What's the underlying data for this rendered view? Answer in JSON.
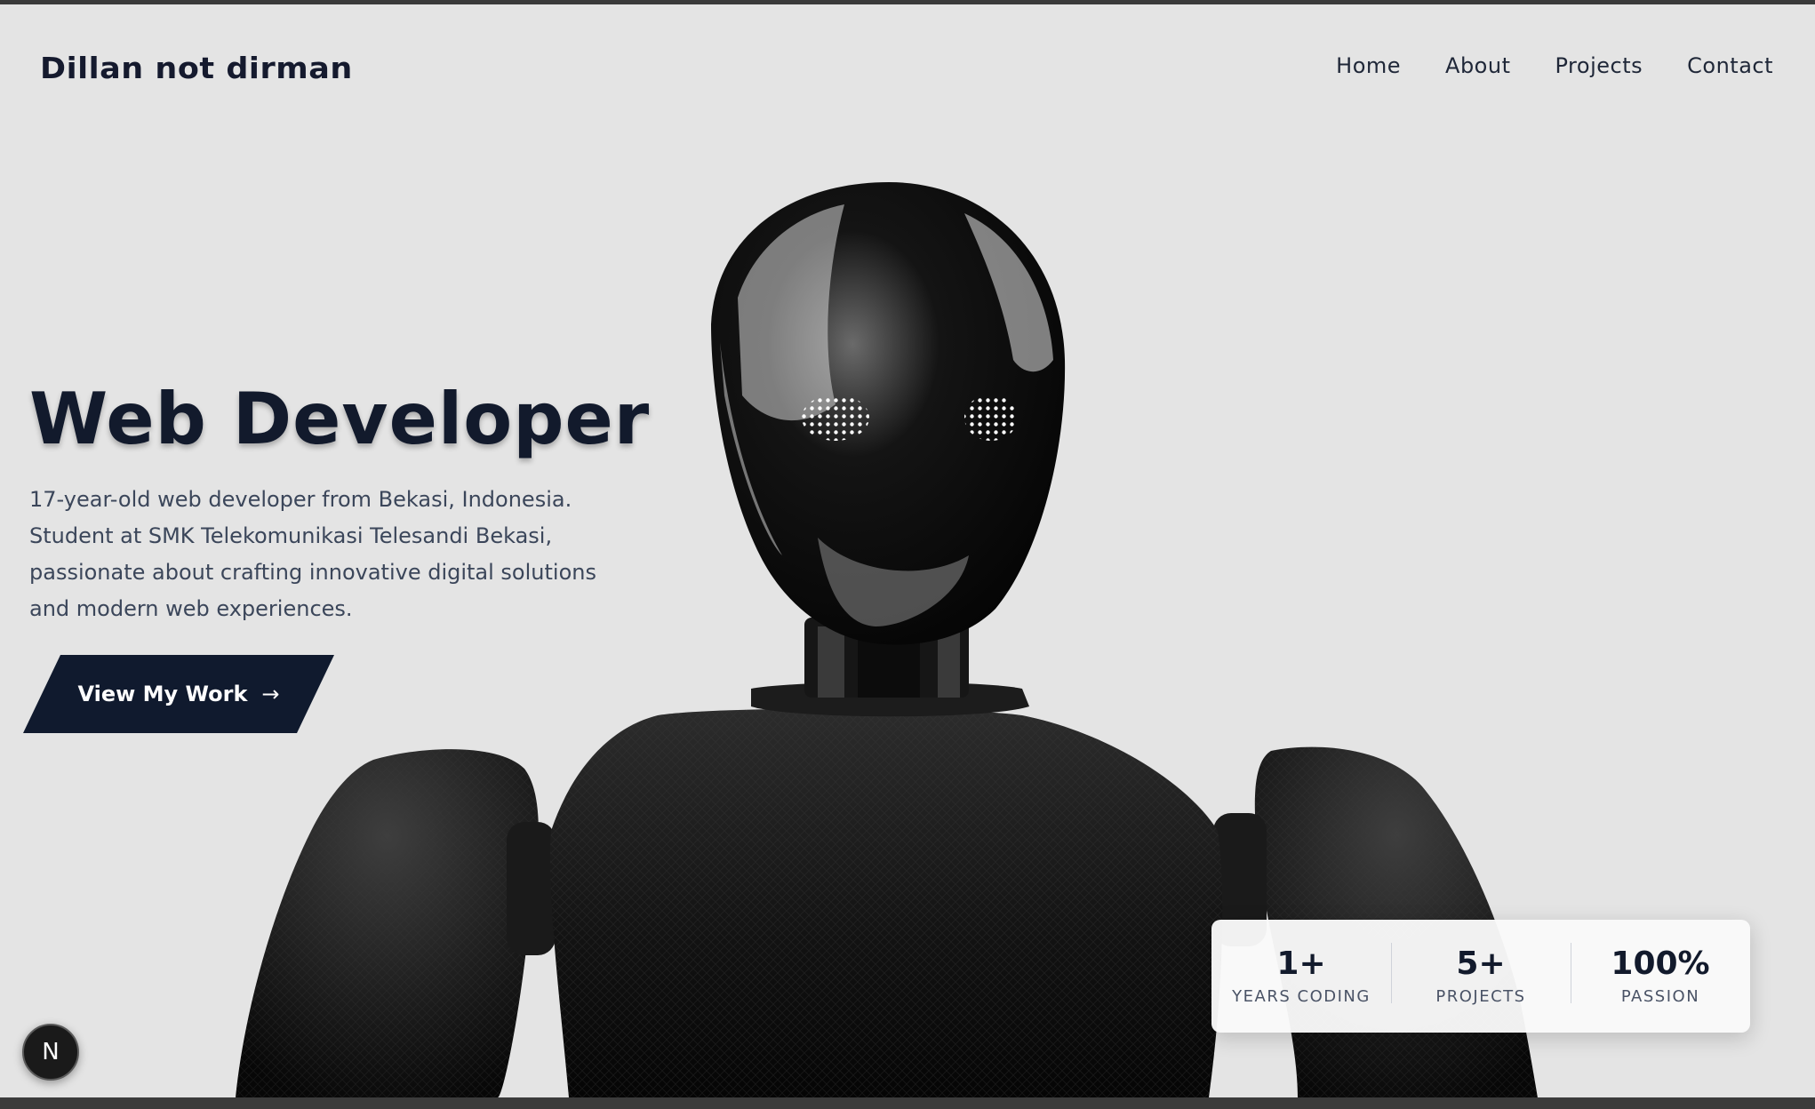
{
  "header": {
    "logo": "Dillan not dirman",
    "nav": [
      {
        "label": "Home"
      },
      {
        "label": "About"
      },
      {
        "label": "Projects"
      },
      {
        "label": "Contact"
      }
    ]
  },
  "hero": {
    "title": "Web Developer",
    "description": "17-year-old web developer from Bekasi, Indonesia. Student at SMK Telekomunikasi Telesandi Bekasi, passionate about crafting innovative digital solutions and modern web experiences.",
    "cta": {
      "label": "View My Work",
      "icon": "arrow-right-icon"
    }
  },
  "stats": [
    {
      "value": "1+",
      "label": "YEARS CODING"
    },
    {
      "value": "5+",
      "label": "PROJECTS"
    },
    {
      "value": "100%",
      "label": "PASSION"
    }
  ],
  "badge": {
    "letter": "N"
  },
  "colors": {
    "background": "#e4e4e4",
    "primary_dark": "#101a2e",
    "text_body": "#3b465a",
    "robot": "#0b0b0b"
  }
}
